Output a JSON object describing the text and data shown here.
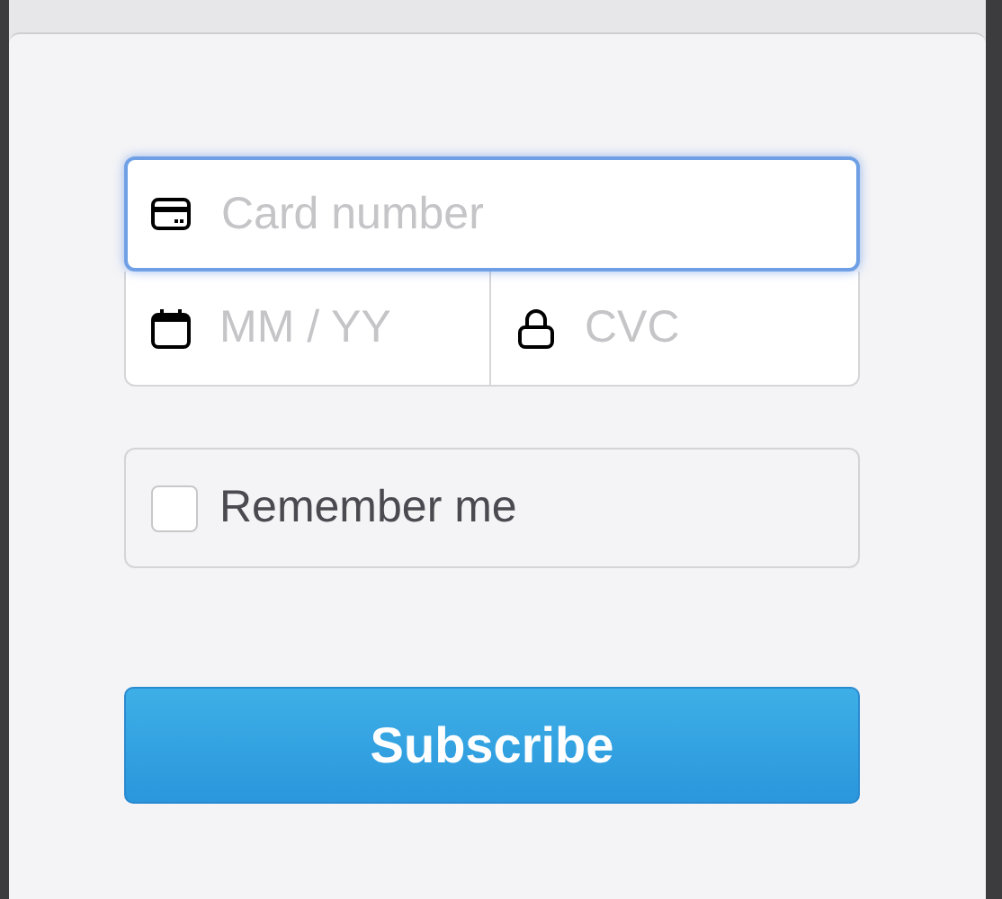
{
  "card_number": {
    "placeholder": "Card number",
    "focused": true
  },
  "expiry": {
    "placeholder": "MM / YY",
    "focused": false
  },
  "cvc": {
    "placeholder": "CVC",
    "focused": false
  },
  "remember": {
    "label": "Remember me",
    "checked": false
  },
  "submit": {
    "label": "Subscribe"
  }
}
